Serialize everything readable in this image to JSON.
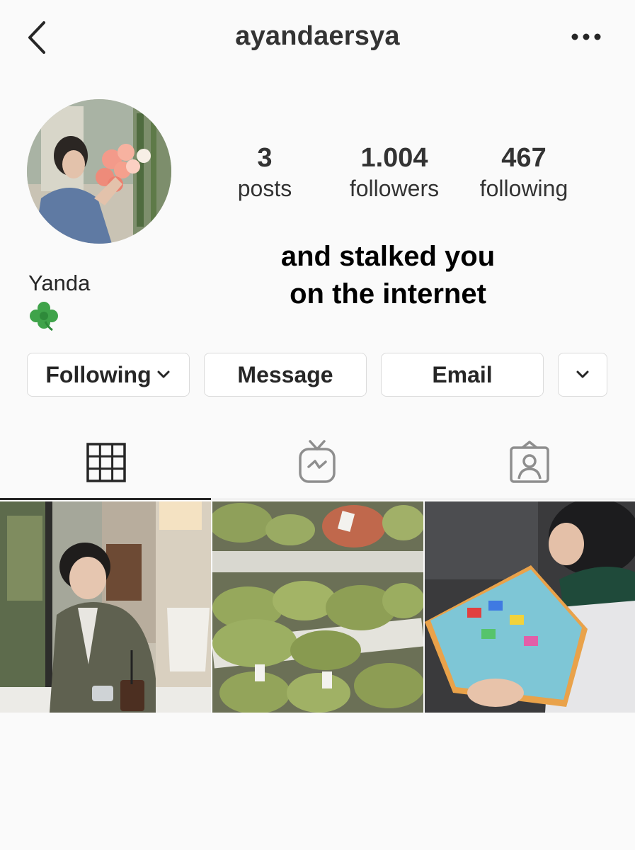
{
  "header": {
    "username": "ayandaersya",
    "back_icon": "chevron-left-icon",
    "more_icon": "more-horizontal-icon"
  },
  "profile": {
    "name": "Yanda",
    "bio_emoji": "🍀",
    "avatar": "profile-photo"
  },
  "stats": [
    {
      "value": "3",
      "label": "posts"
    },
    {
      "value": "1.004",
      "label": "followers"
    },
    {
      "value": "467",
      "label": "following"
    }
  ],
  "caption": {
    "line1": "and stalked you",
    "line2": "on the internet"
  },
  "buttons": {
    "following": "Following",
    "message": "Message",
    "email": "Email",
    "more_icon": "chevron-down-icon"
  },
  "tabs": [
    {
      "icon": "grid-icon",
      "active": true
    },
    {
      "icon": "igtv-icon",
      "active": false
    },
    {
      "icon": "tagged-icon",
      "active": false
    }
  ],
  "posts": [
    {
      "subject": "person in cafe photo"
    },
    {
      "subject": "green plush dinosaurs on shelves"
    },
    {
      "subject": "child reading book"
    }
  ],
  "colors": {
    "background": "#fafafa",
    "text": "#262626",
    "border": "#dbdbdb",
    "icon_inactive": "#8e8e8e"
  }
}
